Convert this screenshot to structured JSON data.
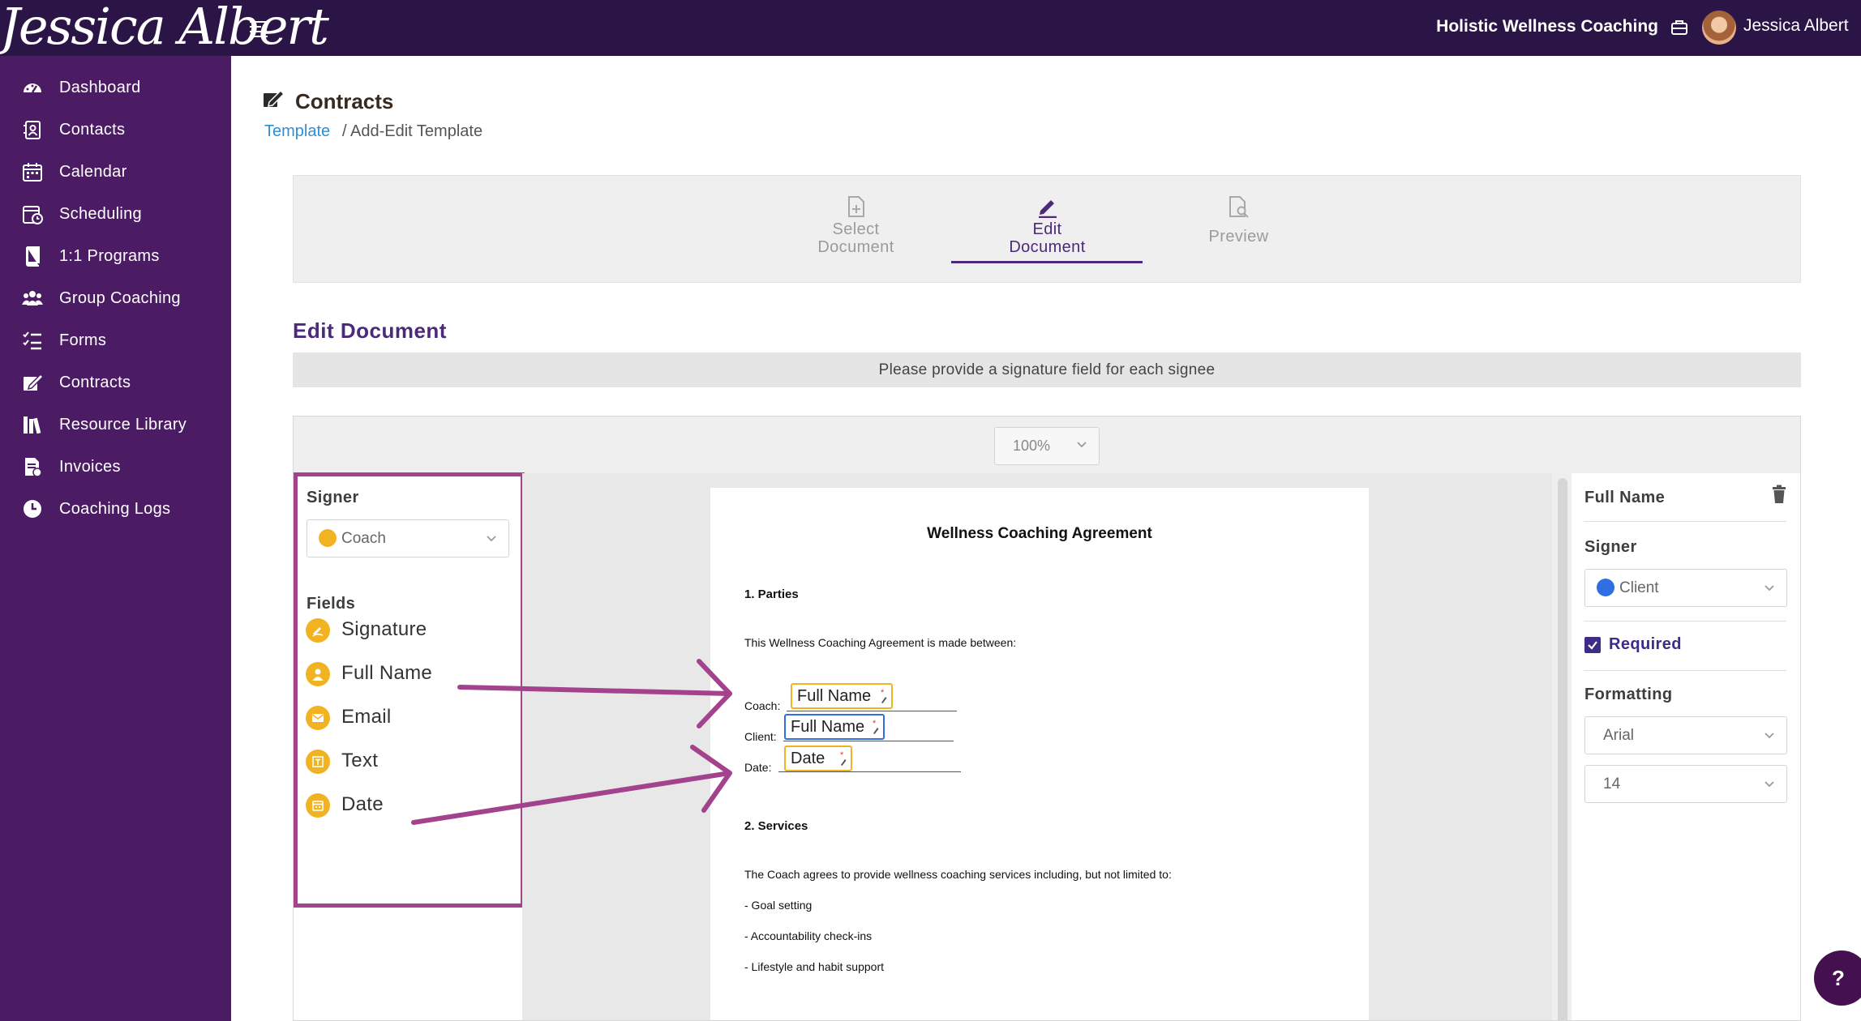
{
  "topbar": {
    "logo_text": "Jessica Albert",
    "business_name": "Holistic Wellness Coaching",
    "user_name": "Jessica Albert"
  },
  "sidebar": {
    "items": [
      {
        "label": "Dashboard",
        "icon": "dashboard-icon"
      },
      {
        "label": "Contacts",
        "icon": "contacts-icon"
      },
      {
        "label": "Calendar",
        "icon": "calendar-icon"
      },
      {
        "label": "Scheduling",
        "icon": "scheduling-icon"
      },
      {
        "label": "1:1 Programs",
        "icon": "book-icon"
      },
      {
        "label": "Group Coaching",
        "icon": "group-icon"
      },
      {
        "label": "Forms",
        "icon": "forms-icon"
      },
      {
        "label": "Contracts",
        "icon": "contracts-icon"
      },
      {
        "label": "Resource Library",
        "icon": "library-icon"
      },
      {
        "label": "Invoices",
        "icon": "invoice-icon"
      },
      {
        "label": "Coaching Logs",
        "icon": "clock-icon"
      }
    ]
  },
  "page": {
    "title": "Contracts",
    "breadcrumb_link": "Template",
    "breadcrumb_rest": "/ Add-Edit Template"
  },
  "stepper": {
    "steps": [
      {
        "line1": "Select",
        "line2": "Document",
        "state": "done"
      },
      {
        "line1": "Edit",
        "line2": "Document",
        "state": "active"
      },
      {
        "line1": "Preview",
        "line2": "",
        "state": "pending"
      }
    ]
  },
  "editor": {
    "section_title": "Edit Document",
    "notice": "Please provide a signature field for each signee",
    "zoom": "100%",
    "left_panel": {
      "signer_label": "Signer",
      "signer_value": "Coach",
      "signer_color": "#f2b322",
      "fields_label": "Fields",
      "fields": [
        {
          "label": "Signature",
          "icon": "signature-icon"
        },
        {
          "label": "Full Name",
          "icon": "person-icon"
        },
        {
          "label": "Email",
          "icon": "email-icon"
        },
        {
          "label": "Text",
          "icon": "text-icon"
        },
        {
          "label": "Date",
          "icon": "date-icon"
        }
      ]
    },
    "document": {
      "title": "Wellness Coaching Agreement",
      "section1": "1. Parties",
      "intro": "This Wellness Coaching Agreement is made between:",
      "coach_label": "Coach:",
      "client_label": "Client:",
      "date_label": "Date:",
      "coach_field": "Full Name",
      "client_field": "Full Name",
      "date_field": "Date",
      "section2": "2. Services",
      "services_intro": "The Coach agrees to provide wellness coaching services including, but not limited to:",
      "services": [
        "- Goal setting",
        "- Accountability check-ins",
        "- Lifestyle and habit support"
      ]
    },
    "right_panel": {
      "field_title": "Full Name",
      "signer_label": "Signer",
      "signer_value": "Client",
      "signer_color": "#2f6fe3",
      "required_label": "Required",
      "required": true,
      "formatting_label": "Formatting",
      "font_value": "Arial",
      "size_value": "14"
    }
  },
  "help_label": "?"
}
